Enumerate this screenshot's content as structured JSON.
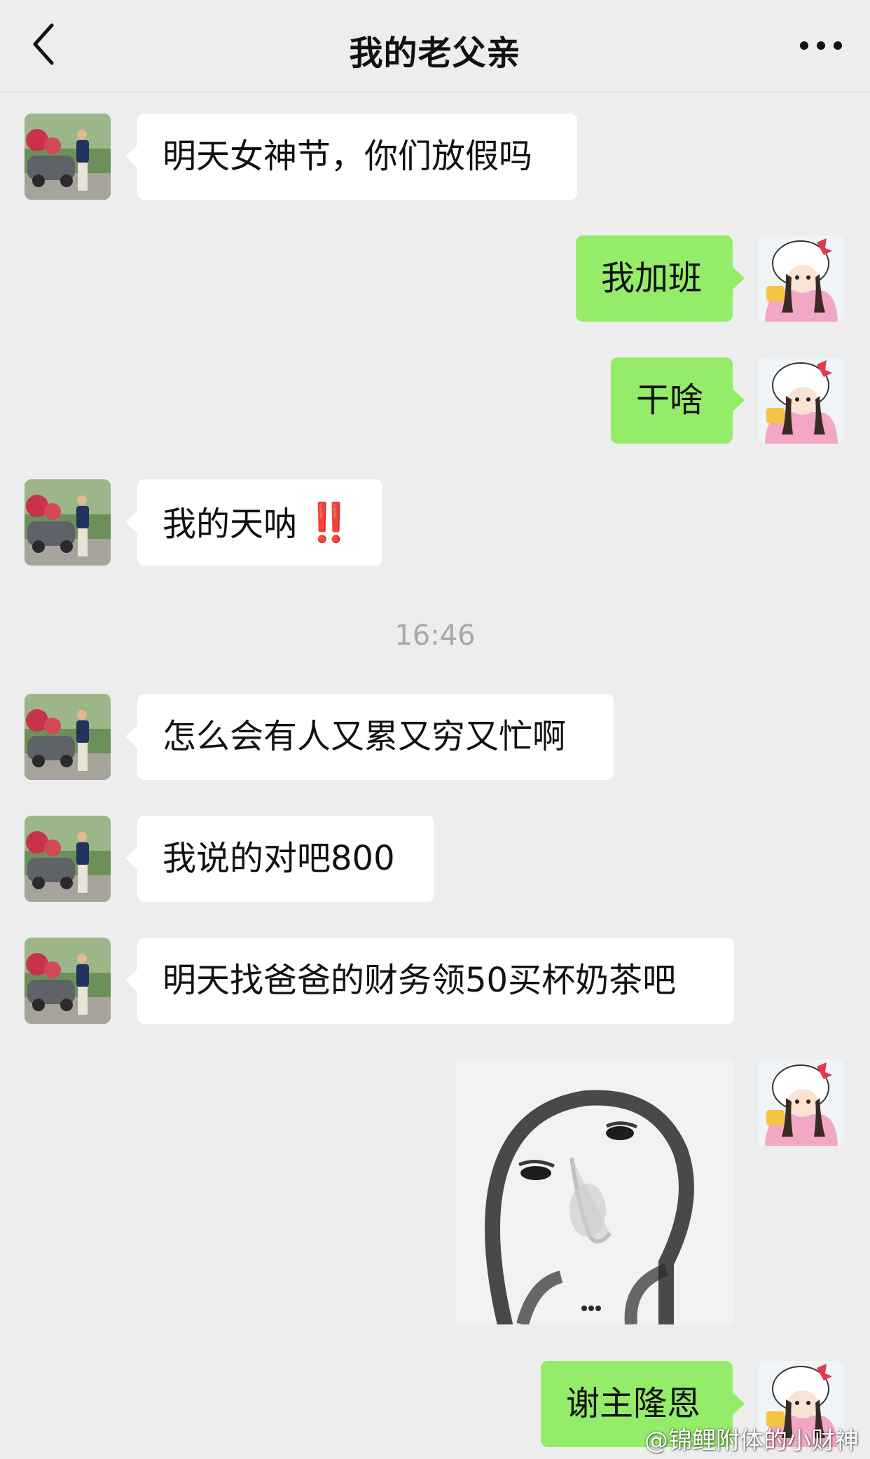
{
  "header": {
    "title": "我的老父亲",
    "back_icon": "chevron-left-icon",
    "more_icon": "more-dots-icon"
  },
  "messages": [
    {
      "side": "left",
      "text": "明天女神节，你们放假吗"
    },
    {
      "side": "right",
      "text": "我加班"
    },
    {
      "side": "right",
      "text": "干啥"
    },
    {
      "side": "left",
      "text": "我的天呐",
      "emoji": "‼️"
    },
    {
      "side": "left",
      "text": "怎么会有人又累又穷又忙啊"
    },
    {
      "side": "left",
      "text": "我说的对吧800"
    },
    {
      "side": "left",
      "text": "明天找爸爸的财务领50买杯奶茶吧"
    },
    {
      "side": "right",
      "type": "sticker",
      "sticker": "meme-face-sticker"
    },
    {
      "side": "right",
      "text": "谢主隆恩"
    }
  ],
  "timestamp": "16:46",
  "watermark": "@锦鲤附体的小财神",
  "colors": {
    "background": "#ededed",
    "bubble_right": "#95ec69",
    "bubble_left": "#ffffff",
    "timestamp": "#a8a8a8",
    "alert": "#e0201e"
  }
}
